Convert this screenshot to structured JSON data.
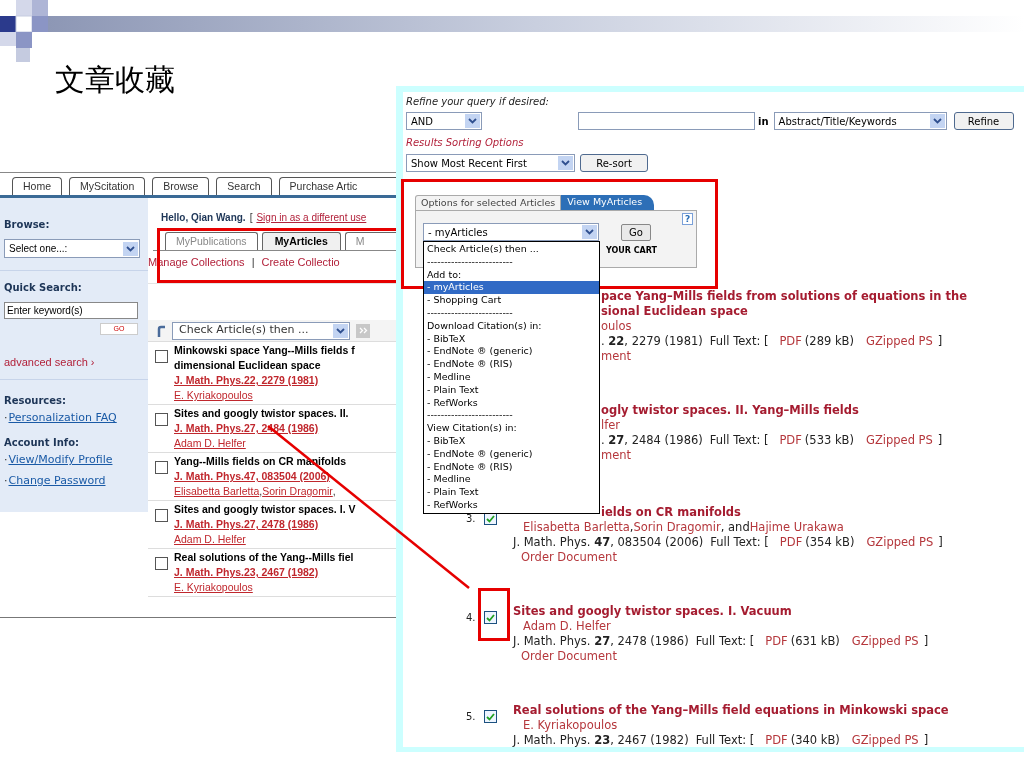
{
  "slide": {
    "title": "文章收藏"
  },
  "scitation_page": {
    "nav_tabs": [
      "Home",
      "MyScitation",
      "Browse",
      "Search",
      "Purchase Artic"
    ],
    "sidebar": {
      "browse_heading": "Browse:",
      "browse_select": "Select one...:",
      "quick_search_heading": "Quick Search:",
      "keyword_value": "Enter keyword(s)",
      "go_button": "GO",
      "advanced_link": "advanced search ›",
      "sections": [
        {
          "heading": "Resources:",
          "links": [
            {
              "bullet": "·",
              "label": "Personalization FAQ"
            }
          ]
        },
        {
          "heading": "Account Info:",
          "links": [
            {
              "bullet": "·",
              "label": "View/Modify Profile"
            },
            {
              "bullet": "·",
              "label": "Change Password"
            }
          ]
        }
      ]
    },
    "main": {
      "greeting": "Hello, Qian Wang.",
      "bracket": "[",
      "sign_in_link": "Sign in as a different use",
      "tabs": [
        {
          "label": "MyPublications",
          "selected": false
        },
        {
          "label": "MyArticles",
          "selected": true
        },
        {
          "label": "M",
          "selected": false
        }
      ],
      "links": [
        "Manage Collections",
        "Create Collectio"
      ],
      "link_separator": "|",
      "action_select": "Check Article(s) then ...",
      "action_button": {
        "disabled": true
      },
      "articles": [
        {
          "checked": false,
          "title_lines": [
            "Minkowski space Yang--Mills fields f",
            "dimensional Euclidean space"
          ],
          "citation": "J. Math. Phys.22, 2279 (1981)",
          "authors": [
            {
              "kind": "link",
              "text": "E. Kyriakopoulos"
            }
          ]
        },
        {
          "checked": false,
          "title_lines": [
            "Sites and googly twistor spaces. II."
          ],
          "citation": "J. Math. Phys.27, 2484 (1986)",
          "authors": [
            {
              "kind": "link",
              "text": "Adam D. Helfer"
            }
          ]
        },
        {
          "checked": false,
          "title_lines": [
            "Yang--Mills fields on CR manifolds"
          ],
          "citation": "J. Math. Phys.47, 083504 (2006)",
          "authors": [
            {
              "kind": "link",
              "text": "Elisabetta Barletta"
            },
            {
              "kind": "plain",
              "text": ", "
            },
            {
              "kind": "link",
              "text": "Sorin Dragomir"
            },
            {
              "kind": "plain",
              "text": ","
            }
          ]
        },
        {
          "checked": false,
          "title_lines": [
            "Sites and googly twistor spaces. I. V"
          ],
          "citation": "J. Math. Phys.27, 2478 (1986)",
          "authors": [
            {
              "kind": "link",
              "text": "Adam D. Helfer"
            }
          ]
        },
        {
          "checked": false,
          "title_lines": [
            "Real solutions of the Yang--Mills fiel"
          ],
          "citation": "J. Math. Phys.23, 2467 (1982)",
          "authors": [
            {
              "kind": "link",
              "text": "E. Kyriakopoulos"
            }
          ]
        }
      ]
    }
  },
  "results_page": {
    "refine_prompt": "Refine your query if desired:",
    "operator_select": "AND",
    "in_label": "in",
    "field_select": "Abstract/Title/Keywords",
    "refine_button": "Refine",
    "sorting_heading": "Results Sorting Options",
    "sort_select": "Show Most Recent First",
    "resort_button": "Re-sort",
    "options_panel": {
      "tabs": [
        {
          "label": "Options for selected Articles",
          "selected": true
        },
        {
          "label": "View MyArticles",
          "selected": false
        }
      ],
      "help": "?",
      "select": "- myArticles",
      "go_button": "Go",
      "cart_text": "YOUR CART",
      "dropdown": [
        {
          "label": "Check Article(s) then ...",
          "selected": false
        },
        {
          "label": "-------------------------",
          "selected": false
        },
        {
          "label": "Add to:",
          "selected": false
        },
        {
          "label": "- myArticles",
          "selected": true
        },
        {
          "label": "- Shopping Cart",
          "selected": false
        },
        {
          "label": "-------------------------",
          "selected": false
        },
        {
          "label": "Download Citation(s) in:",
          "selected": false
        },
        {
          "label": "- BibTeX",
          "selected": false
        },
        {
          "label": "- EndNote ® (generic)",
          "selected": false
        },
        {
          "label": "- EndNote ® (RIS)",
          "selected": false
        },
        {
          "label": "- Medline",
          "selected": false
        },
        {
          "label": "- Plain Text",
          "selected": false
        },
        {
          "label": "- RefWorks",
          "selected": false
        },
        {
          "label": "-------------------------",
          "selected": false
        },
        {
          "label": "View Citation(s) in:",
          "selected": false
        },
        {
          "label": "- BibTeX",
          "selected": false
        },
        {
          "label": "- EndNote ® (generic)",
          "selected": false
        },
        {
          "label": "- EndNote ® (RIS)",
          "selected": false
        },
        {
          "label": "- Medline",
          "selected": false
        },
        {
          "label": "- Plain Text",
          "selected": false
        },
        {
          "label": "- RefWorks",
          "selected": false
        }
      ]
    },
    "results": [
      {
        "kind": "behind_menu",
        "title_lines": [
          "pace Yang–Mills fields from solutions of equations in the",
          "sional Euclidean space"
        ],
        "authors": [
          {
            "kind": "link",
            "text": "oulos"
          }
        ],
        "citation": ". **22**, 2279 (1981)",
        "full_text_label": "Full Text: [",
        "pdf": "PDF",
        "size": "(289 kB)",
        "gzipped": "GZipped PS",
        "bracket": "]",
        "order": "ment"
      },
      {
        "kind": "behind_menu",
        "title_lines": [
          "ogly twistor spaces. II. Yang–Mills fields"
        ],
        "authors": [
          {
            "kind": "link",
            "text": "lfer"
          }
        ],
        "citation": ". **27**, 2484 (1986)",
        "full_text_label": "Full Text: [",
        "pdf": "PDF",
        "size": "(533 kB)",
        "gzipped": "GZipped PS",
        "bracket": "]",
        "order": "ment"
      },
      {
        "kind": "title_behind_menu",
        "number": "3.",
        "checked": true,
        "title_lines": [
          "ields on CR manifolds"
        ],
        "authors": [
          {
            "kind": "link",
            "text": "Elisabetta Barletta"
          },
          {
            "kind": "plain",
            "text": ", "
          },
          {
            "kind": "link",
            "text": "Sorin Dragomir"
          },
          {
            "kind": "plain",
            "text": ", and "
          },
          {
            "kind": "link",
            "text": "Hajime Urakawa"
          }
        ],
        "citation": "J. Math. Phys. **47**, 083504 (2006)",
        "full_text_label": "Full Text: [",
        "pdf": "PDF",
        "size": "(354 kB)",
        "gzipped": "GZipped PS",
        "bracket": "]",
        "order": "Order Document"
      },
      {
        "kind": "full",
        "number": "4.",
        "checked": true,
        "title_lines": [
          "Sites and googly twistor spaces. I. Vacuum"
        ],
        "authors": [
          {
            "kind": "link",
            "text": "Adam D. Helfer"
          }
        ],
        "citation": "J. Math. Phys. **27**, 2478 (1986)",
        "full_text_label": "Full Text: [",
        "pdf": "PDF",
        "size": "(631 kB)",
        "gzipped": "GZipped PS",
        "bracket": "]",
        "order": "Order Document"
      },
      {
        "kind": "full",
        "number": "5.",
        "checked": true,
        "title_lines": [
          "Real solutions of the Yang–Mills field equations in Minkowski space"
        ],
        "authors": [
          {
            "kind": "link",
            "text": "E. Kyriakopoulos"
          }
        ],
        "citation": "J. Math. Phys. **23**, 2467 (1982)",
        "full_text_label": "Full Text: [",
        "pdf": "PDF",
        "size": "(340 kB)",
        "gzipped": "GZipped PS",
        "bracket": "]"
      }
    ]
  }
}
